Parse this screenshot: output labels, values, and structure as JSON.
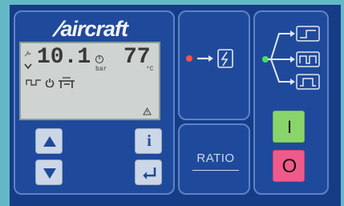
{
  "brand": {
    "name": "aircraft"
  },
  "display": {
    "pressure_value": "10.1",
    "pressure_unit": "bar",
    "temperature_value": "77",
    "temperature_unit": "°C"
  },
  "controls": {
    "ratio_label": "RATIO",
    "info_label": "i",
    "on_label": "I",
    "off_label": "O"
  },
  "colors": {
    "background": "#64b8c6",
    "panel": "#173c86",
    "module": "#1f4a9c",
    "led_red": "#ff4f4f",
    "led_green": "#46e06a",
    "on_button": "#89d56c",
    "off_button": "#ef5a8a"
  }
}
